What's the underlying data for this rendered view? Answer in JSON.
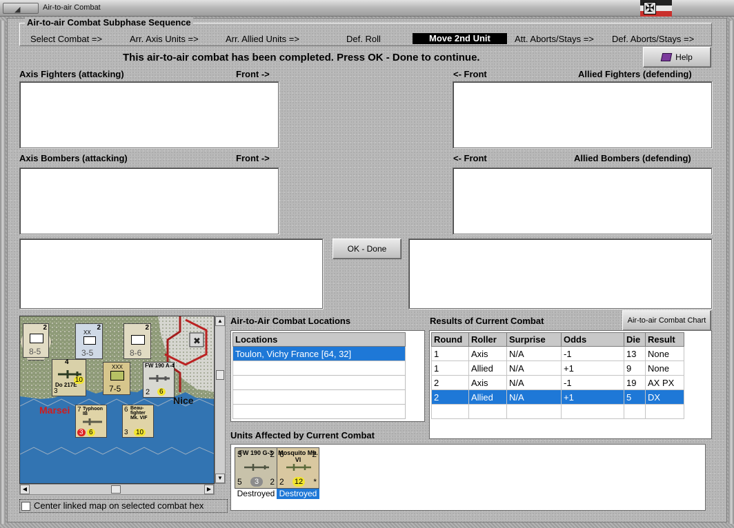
{
  "window": {
    "title": "Air-to-air Combat"
  },
  "subphase": {
    "title": "Air-to-air Combat Subphase Sequence",
    "steps": [
      {
        "label": "Select Combat =>"
      },
      {
        "label": "Arr. Axis Units =>"
      },
      {
        "label": "Arr. Allied Units =>"
      },
      {
        "label": "Def. Roll"
      },
      {
        "label": "Move 2nd Unit"
      },
      {
        "label": "Att. Aborts/Stays =>"
      },
      {
        "label": "Def. Aborts/Stays =>"
      }
    ]
  },
  "status_message": "This air-to-air combat has been completed.  Press OK - Done to continue.",
  "help_button": "Help",
  "panels": {
    "axis_fighters": "Axis Fighters (attacking)",
    "axis_fighters_front": "Front ->",
    "allied_fighters": "Allied Fighters (defending)",
    "allied_fighters_front": "<- Front",
    "axis_bombers": "Axis Bombers (attacking)",
    "axis_bombers_front": "Front ->",
    "allied_bombers": "Allied Bombers (defending)",
    "allied_bombers_front": "<- Front"
  },
  "ok_button": "OK - Done",
  "map": {
    "center_checkbox_label": "Center linked map on selected combat hex",
    "city_labels": [
      "Marsei",
      "Nice"
    ],
    "counters": [
      {
        "top": "2",
        "mid": "8-5"
      },
      {
        "top": "2",
        "label": "XX",
        "mid": "3-5"
      },
      {
        "top": "2",
        "mid": "8-6"
      },
      {
        "top": "4",
        "name": "Do 217E",
        "val": "10",
        "bl": "3"
      },
      {
        "top": "XXX",
        "mid": "7-5"
      },
      {
        "top": "6",
        "name": "FW 190 A-4",
        "bl": "2",
        "val": "6"
      },
      {
        "name": "Typhoon IB",
        "tl": "7",
        "bl": "3",
        "val": "6"
      },
      {
        "name": "Beau-fighter Mk. VIF",
        "tl": "6",
        "bl": "3",
        "val": "10"
      }
    ]
  },
  "locations": {
    "heading": "Air-to-Air Combat Locations",
    "column": "Locations",
    "rows": [
      "Toulon, Vichy France [64, 32]",
      "",
      "",
      "",
      ""
    ]
  },
  "results": {
    "heading": "Results of Current Combat",
    "chart_button": "Air-to-air Combat Chart",
    "columns": [
      "Round",
      "Roller",
      "Surprise",
      "Odds",
      "Die",
      "Result"
    ],
    "rows": [
      {
        "round": "1",
        "roller": "Axis",
        "surprise": "N/A",
        "odds": "-1",
        "die": "13",
        "result": "None"
      },
      {
        "round": "1",
        "roller": "Allied",
        "surprise": "N/A",
        "odds": "+1",
        "die": "9",
        "result": "None"
      },
      {
        "round": "2",
        "roller": "Axis",
        "surprise": "N/A",
        "odds": "-1",
        "die": "19",
        "result": "AX PX"
      },
      {
        "round": "2",
        "roller": "Allied",
        "surprise": "N/A",
        "odds": "+1",
        "die": "5",
        "result": "DX"
      },
      {
        "round": "",
        "roller": "",
        "surprise": "",
        "odds": "",
        "die": "",
        "result": ""
      }
    ]
  },
  "units_affected": {
    "heading": "Units Affected by Current Combat",
    "units": [
      {
        "name": "FW 190 G-3",
        "tl": "5",
        "tr": "2",
        "bl": "5",
        "mid": "3",
        "br": "2",
        "status": "Destroyed",
        "color": "#c8c2aa"
      },
      {
        "name": "Mosquito Mk. VI",
        "tl": "6",
        "tr": "2",
        "bl": "2",
        "mid": "12",
        "br": "*",
        "status": "Destroyed",
        "color": "#d9c8a0"
      }
    ]
  }
}
